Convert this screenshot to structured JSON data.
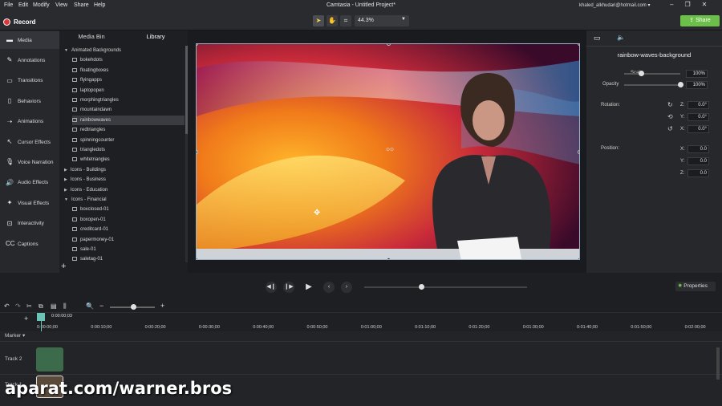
{
  "menu": [
    "File",
    "Edit",
    "Modify",
    "View",
    "Share",
    "Help"
  ],
  "title": "Camtasia - Untitled Project*",
  "user": "khaled_alkhudari@hotmail.com",
  "record_label": "Record",
  "zoom": "44.3%",
  "share_label": "Share",
  "sidebar": [
    {
      "label": "Media",
      "icon": "media-icon"
    },
    {
      "label": "Annotations",
      "icon": "annotations-icon"
    },
    {
      "label": "Transitions",
      "icon": "transitions-icon"
    },
    {
      "label": "Behaviors",
      "icon": "behaviors-icon"
    },
    {
      "label": "Animations",
      "icon": "animations-icon"
    },
    {
      "label": "Cursor Effects",
      "icon": "cursor-icon"
    },
    {
      "label": "Voice Narration",
      "icon": "mic-icon"
    },
    {
      "label": "Audio Effects",
      "icon": "audio-icon"
    },
    {
      "label": "Visual Effects",
      "icon": "visual-icon"
    },
    {
      "label": "Interactivity",
      "icon": "interactivity-icon"
    },
    {
      "label": "Captions",
      "icon": "captions-icon"
    }
  ],
  "library": {
    "tabs": [
      "Media Bin",
      "Library"
    ],
    "tree": [
      {
        "label": "Animated Backgrounds",
        "type": "folder-open"
      },
      {
        "label": "bokehdots",
        "type": "file"
      },
      {
        "label": "floatingboxes",
        "type": "file"
      },
      {
        "label": "flyingapps",
        "type": "file"
      },
      {
        "label": "laptopopen",
        "type": "file"
      },
      {
        "label": "morphingtriangles",
        "type": "file"
      },
      {
        "label": "mountaindawn",
        "type": "file"
      },
      {
        "label": "rainbowwaves",
        "type": "file",
        "selected": true
      },
      {
        "label": "redtriangles",
        "type": "file"
      },
      {
        "label": "spinningcounter",
        "type": "file"
      },
      {
        "label": "triangledots",
        "type": "file"
      },
      {
        "label": "whitetriangles",
        "type": "file"
      },
      {
        "label": "Icons - Buildings",
        "type": "folder"
      },
      {
        "label": "Icons - Business",
        "type": "folder"
      },
      {
        "label": "Icons - Education",
        "type": "folder"
      },
      {
        "label": "Icons - Financial",
        "type": "folder-open"
      },
      {
        "label": "boxclosed-01",
        "type": "file"
      },
      {
        "label": "boxopen-01",
        "type": "file"
      },
      {
        "label": "creditcard-01",
        "type": "file"
      },
      {
        "label": "papermoney-01",
        "type": "file"
      },
      {
        "label": "sale-01",
        "type": "file"
      },
      {
        "label": "saletag-01",
        "type": "file"
      }
    ]
  },
  "properties": {
    "title": "rainbow-waves-background",
    "scale_label": "Scale",
    "scale": "100%",
    "scale_level": 0.3,
    "opacity_label": "Opacity",
    "opacity": "100%",
    "opacity_level": 1.0,
    "rotation_label": "Rotation:",
    "rotation": [
      {
        "axis": "Z:",
        "value": "0.0°"
      },
      {
        "axis": "Y:",
        "value": "0.0°"
      },
      {
        "axis": "X:",
        "value": "0.0°"
      }
    ],
    "position_label": "Position:",
    "position": [
      {
        "axis": "X:",
        "value": "0.0"
      },
      {
        "axis": "Y:",
        "value": "0.0"
      },
      {
        "axis": "Z:",
        "value": "0.0"
      }
    ]
  },
  "properties_button": "Properties",
  "timeline": {
    "current_time": "0:00:00;03",
    "marker_label": "Marker",
    "ticks": [
      "0:00:00;00",
      "0:00:10;00",
      "0:00:20;00",
      "0:00:30;00",
      "0:00:40;00",
      "0:00:50;00",
      "0:01:00;00",
      "0:01:10;00",
      "0:01:20;00",
      "0:01:30;00",
      "0:01:40;00",
      "0:01:50;00",
      "0:02:00;00"
    ],
    "tracks": [
      "Track 2",
      "Track 1"
    ],
    "scrub_level": 0.35
  },
  "watermark": "aparat.com/warner.bros",
  "colors": {
    "accent_green": "#6cc04a",
    "record_red": "#e0353b",
    "playhead": "#6ac3b4"
  }
}
